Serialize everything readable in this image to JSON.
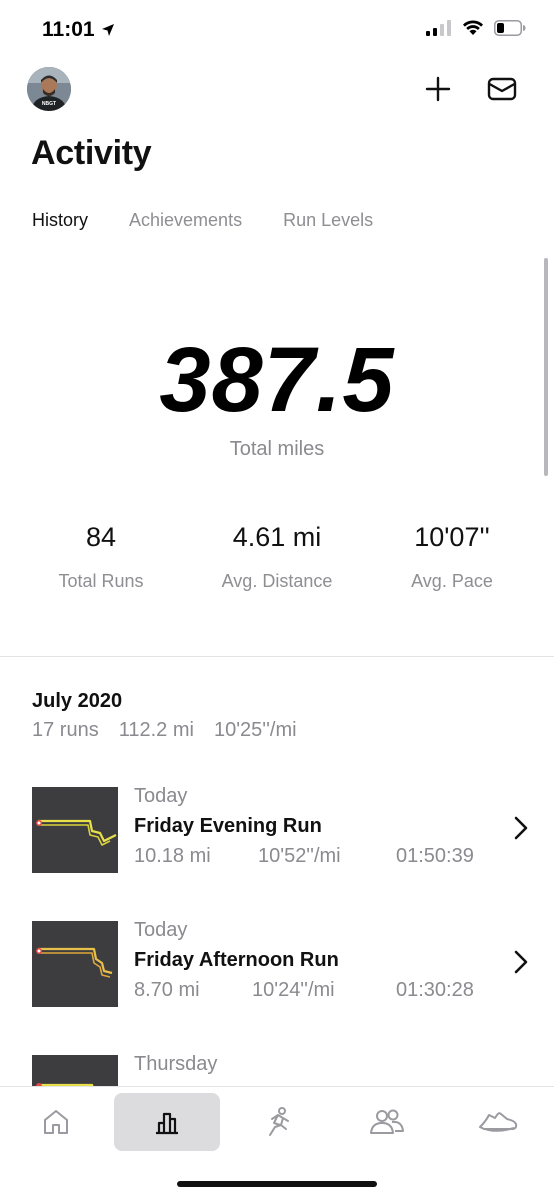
{
  "status_bar": {
    "time": "11:01",
    "icons": [
      "location-arrow-icon",
      "cellular-signal-icon",
      "wifi-icon",
      "battery-icon"
    ]
  },
  "header": {
    "avatar_label": "NBGT",
    "add_icon": "plus-icon",
    "inbox_icon": "mail-icon"
  },
  "page": {
    "title": "Activity"
  },
  "tabs": [
    {
      "label": "History",
      "active": true
    },
    {
      "label": "Achievements",
      "active": false
    },
    {
      "label": "Run Levels",
      "active": false
    }
  ],
  "summary": {
    "total_value": "387.5",
    "total_label": "Total miles",
    "stats": [
      {
        "value": "84",
        "label": "Total Runs"
      },
      {
        "value": "4.61 mi",
        "label": "Avg. Distance"
      },
      {
        "value": "10'07''",
        "label": "Avg. Pace"
      }
    ]
  },
  "month": {
    "title": "July 2020",
    "runs": "17 runs",
    "distance": "112.2 mi",
    "pace": "10'25''/mi"
  },
  "runs": [
    {
      "day": "Today",
      "name": "Friday Evening Run",
      "distance": "10.18 mi",
      "pace": "10'52''/mi",
      "duration": "01:50:39"
    },
    {
      "day": "Today",
      "name": "Friday Afternoon Run",
      "distance": "8.70 mi",
      "pace": "10'24''/mi",
      "duration": "01:30:28"
    },
    {
      "day": "Thursday",
      "name": "",
      "distance": "",
      "pace": "",
      "duration": ""
    }
  ],
  "tab_bar": [
    {
      "icon": "home-icon",
      "active": false
    },
    {
      "icon": "activity-chart-icon",
      "active": true
    },
    {
      "icon": "runner-icon",
      "active": false
    },
    {
      "icon": "friends-icon",
      "active": false
    },
    {
      "icon": "shoe-icon",
      "active": false
    }
  ],
  "colors": {
    "route": "#e8e04a",
    "map_bg": "#3d3d3f",
    "secondary_text": "#8a8a8f",
    "active_tab_bg": "#dcdcdf"
  }
}
